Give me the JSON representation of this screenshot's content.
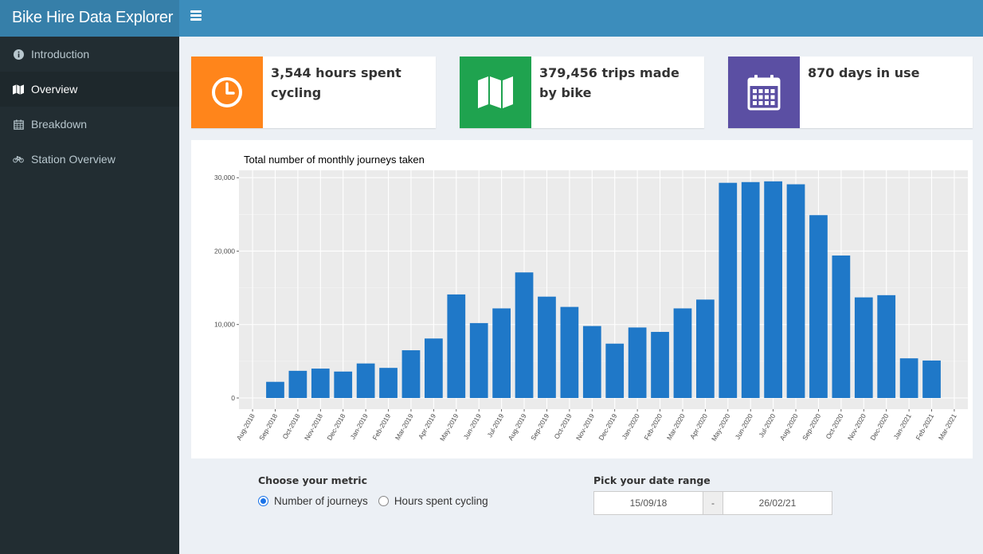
{
  "app": {
    "title": "Bike Hire Data Explorer"
  },
  "sidebar": {
    "items": [
      {
        "label": "Introduction",
        "icon": "info-circle-icon"
      },
      {
        "label": "Overview",
        "icon": "map-icon",
        "active": true
      },
      {
        "label": "Breakdown",
        "icon": "calendar-icon"
      },
      {
        "label": "Station Overview",
        "icon": "bicycle-icon"
      }
    ]
  },
  "infoboxes": [
    {
      "text": "3,544 hours spent cycling",
      "color": "#ff851b",
      "icon": "clock-icon"
    },
    {
      "text": "379,456 trips made by bike",
      "color": "#00a65a",
      "icon": "map-icon"
    },
    {
      "text": "870 days in use",
      "color": "#605ca8",
      "icon": "calendar-icon"
    }
  ],
  "chart_data": {
    "type": "bar",
    "title": "Total number of monthly journeys taken",
    "xlabel": "",
    "ylabel": "",
    "categories": [
      "Aug-2018",
      "Sep-2018",
      "Oct-2018",
      "Nov-2018",
      "Dec-2018",
      "Jan-2019",
      "Feb-2019",
      "Mar-2019",
      "Apr-2019",
      "May-2019",
      "Jun-2019",
      "Jul-2019",
      "Aug-2019",
      "Sep-2019",
      "Oct-2019",
      "Nov-2019",
      "Dec-2019",
      "Jan-2020",
      "Feb-2020",
      "Mar-2020",
      "Apr-2020",
      "May-2020",
      "Jun-2020",
      "Jul-2020",
      "Aug-2020",
      "Sep-2020",
      "Oct-2020",
      "Nov-2020",
      "Dec-2020",
      "Jan-2021",
      "Feb-2021",
      "Mar-2021"
    ],
    "values": [
      0,
      2200,
      3700,
      4000,
      3600,
      4700,
      4100,
      6500,
      8100,
      14100,
      10200,
      12200,
      17100,
      13800,
      12400,
      9800,
      7400,
      9600,
      9000,
      12200,
      13400,
      29300,
      29400,
      29500,
      29100,
      24900,
      19400,
      13700,
      14000,
      5400,
      5100,
      0
    ],
    "ylim": [
      0,
      31000
    ],
    "yticks": [
      0,
      10000,
      20000,
      30000
    ],
    "ytick_labels": [
      "0",
      "10,000",
      "20,000",
      "30,000"
    ],
    "grid": true,
    "bar_color": "#1f78c8",
    "panel_bg": "#ebebeb"
  },
  "controls": {
    "metric_label": "Choose your metric",
    "metric_options": [
      {
        "label": "Number of journeys",
        "checked": true
      },
      {
        "label": "Hours spent cycling",
        "checked": false
      }
    ],
    "date_label": "Pick your date range",
    "date_start": "15/09/18",
    "date_sep": "-",
    "date_end": "26/02/21"
  }
}
